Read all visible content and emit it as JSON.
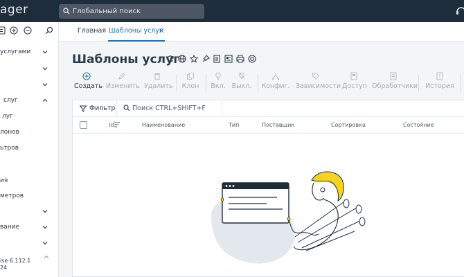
{
  "topbar": {
    "brand_text": "ager",
    "search_label": "Глобальный поиск"
  },
  "sidebar": {
    "items": [
      {
        "label": "услугами"
      },
      {
        "label": ""
      },
      {
        "label": ""
      },
      {
        "label": "слуг"
      },
      {
        "label": "луг"
      },
      {
        "label": "лонов"
      },
      {
        "label": "ьтров"
      },
      {
        "label": "ия"
      },
      {
        "label": "метров"
      },
      {
        "label": ""
      },
      {
        "label": "вание"
      },
      {
        "label": ""
      }
    ],
    "version_line1": "ise 6.112.1",
    "version_line2": "24"
  },
  "tabs": [
    {
      "label": "Главная"
    },
    {
      "label": "Шаблоны услуг",
      "active": true
    }
  ],
  "page": {
    "title": "Шаблоны услуг"
  },
  "toolbar": {
    "buttons": [
      {
        "label": "Создать",
        "icon": "plus-circle-icon",
        "enabled": true
      },
      {
        "label": "Изменить",
        "icon": "pencil-icon",
        "enabled": false
      },
      {
        "label": "Удалить",
        "icon": "trash-icon",
        "enabled": false
      },
      {
        "label": "Клон",
        "icon": "copy-icon",
        "enabled": false
      },
      {
        "label": "Вкл.",
        "icon": "bulb-on-icon",
        "enabled": false
      },
      {
        "label": "Выкл.",
        "icon": "bulb-off-icon",
        "enabled": false
      },
      {
        "label": "Конфиг.",
        "icon": "config-icon",
        "enabled": false
      },
      {
        "label": "Зависимости",
        "icon": "tag-icon",
        "enabled": false
      },
      {
        "label": "Доступ",
        "icon": "access-icon",
        "enabled": false
      },
      {
        "label": "Обработчики",
        "icon": "handlers-icon",
        "enabled": false
      },
      {
        "label": "История",
        "icon": "history-icon",
        "enabled": false
      }
    ]
  },
  "grid": {
    "filter_label": "Фильтр",
    "search_placeholder": "Поиск CTRL+SHIFT+F",
    "columns": [
      "Id",
      "Наименование",
      "Тип",
      "Поставщик",
      "Сортировка",
      "Состояние"
    ]
  },
  "colors": {
    "topbar": "#1e2d3c",
    "accent": "#1f6fb8",
    "illustration_yellow": "#f7d21e"
  }
}
